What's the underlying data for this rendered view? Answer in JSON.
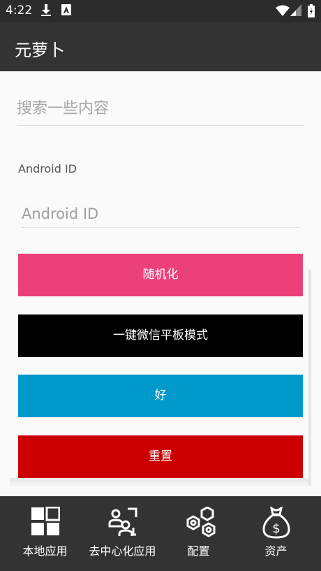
{
  "status_bar": {
    "time": "4:22",
    "icons": [
      "download-icon",
      "a-badge-icon",
      "wifi-icon",
      "signal-icon",
      "battery-icon"
    ]
  },
  "app_bar": {
    "title": "元萝卜"
  },
  "search": {
    "placeholder": "搜索一些内容",
    "value": ""
  },
  "android_id": {
    "label": "Android ID",
    "placeholder": "Android ID",
    "value": ""
  },
  "buttons": {
    "randomize": "随机化",
    "wechat_tablet": "一键微信平板模式",
    "ok": "好",
    "reset": "重置"
  },
  "bottom_nav": [
    {
      "label": "本地应用",
      "icon": "grid-apps-icon"
    },
    {
      "label": "去中心化应用",
      "icon": "people-icon"
    },
    {
      "label": "配置",
      "icon": "hexagons-icon"
    },
    {
      "label": "资产",
      "icon": "money-bag-icon"
    }
  ],
  "colors": {
    "app_bar": "#333333",
    "randomize_button": "#ec407a",
    "wechat_button": "#000000",
    "ok_button": "#0099cc",
    "reset_button": "#cc0000"
  }
}
